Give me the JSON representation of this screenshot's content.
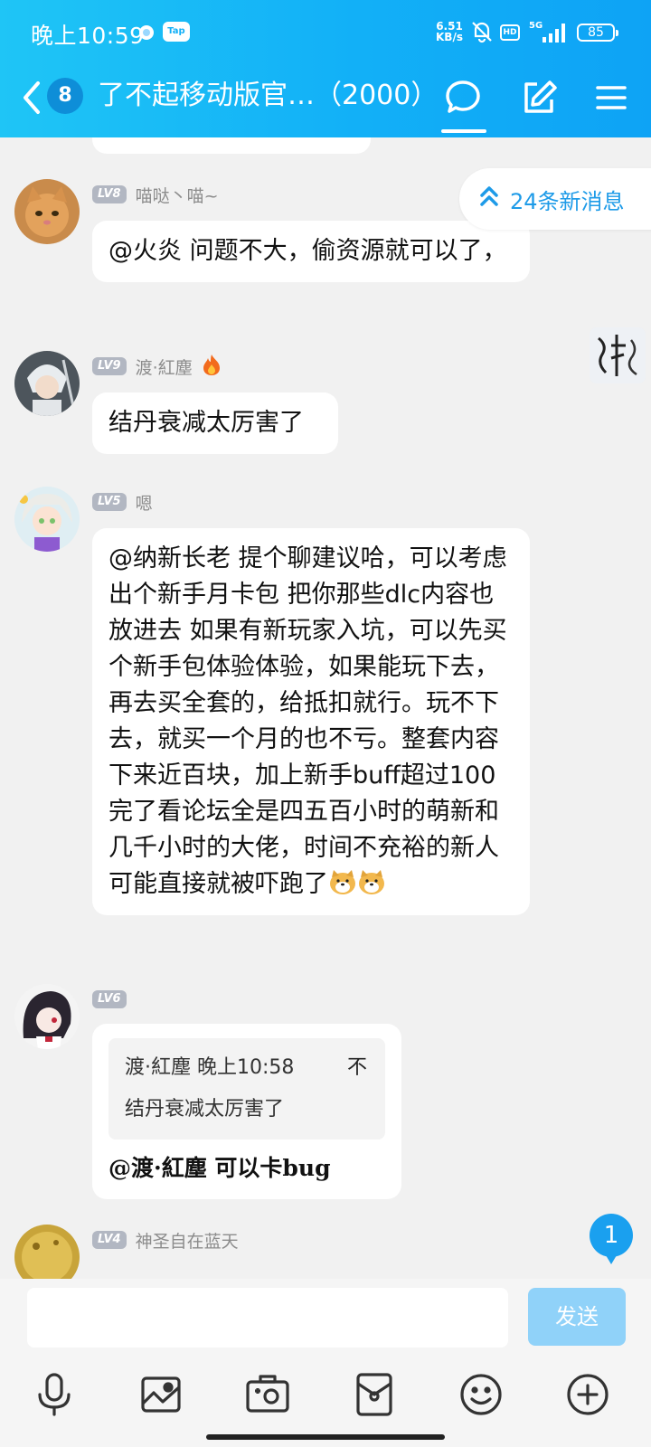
{
  "status_bar": {
    "time": "晚上10:59",
    "tap_label": "Tap",
    "net_speed_value": "6.51",
    "net_speed_unit": "KB/s",
    "hd_label": "HD",
    "network": "5G",
    "battery": "85"
  },
  "navbar": {
    "unread_count": "8",
    "title": "了不起移动版官…（2000）"
  },
  "new_messages_label": "24条新消息",
  "messages": [
    {
      "level": "LV8",
      "nickname": "喵哒丶喵~",
      "text": "@火炎 问题不大，偷资源就可以了，",
      "icon": "cat-avatar"
    },
    {
      "level": "LV9",
      "nickname": "渡·紅塵",
      "nickname_icon": "fire-icon",
      "text": "结丹衰减太厉害了",
      "icon": "anime-swordsman-avatar"
    },
    {
      "level": "LV5",
      "nickname": "嗯",
      "text": "@纳新长老 提个聊建议哈，可以考虑出个新手月卡包  把你那些dlc内容也放进去  如果有新玩家入坑，可以先买个新手包体验体验，如果能玩下去，再去买全套的，给抵扣就行。玩不下去，就买一个月的也不亏。整套内容下来近百块，加上新手buff超过100  完了看论坛全是四五百小时的萌新和几千小时的大佬，时间不充裕的新人可能直接就被吓跑了",
      "icon": "anime-girl-avatar"
    },
    {
      "level": "LV6",
      "nickname": "",
      "quote_header": "渡·紅塵 晚上10:58",
      "quote_close": "不",
      "quote_text": "结丹衰减太厉害了",
      "reply_text": "@渡·紅塵 可以卡bug",
      "icon": "dark-hair-girl-avatar"
    },
    {
      "level": "LV4",
      "nickname": "神圣自在蓝天",
      "icon": "yellow-avatar"
    }
  ],
  "floating_badge": "1",
  "input": {
    "placeholder": "",
    "send_label": "发送"
  },
  "toolbar_icons": [
    "microphone-icon",
    "image-icon",
    "camera-icon",
    "red-packet-icon",
    "emoji-icon",
    "plus-icon"
  ],
  "colors": {
    "header_start": "#1fc5f6",
    "header_end": "#0ea3f5",
    "accent": "#1aa0ef",
    "send_disabled": "#90d2f9"
  }
}
